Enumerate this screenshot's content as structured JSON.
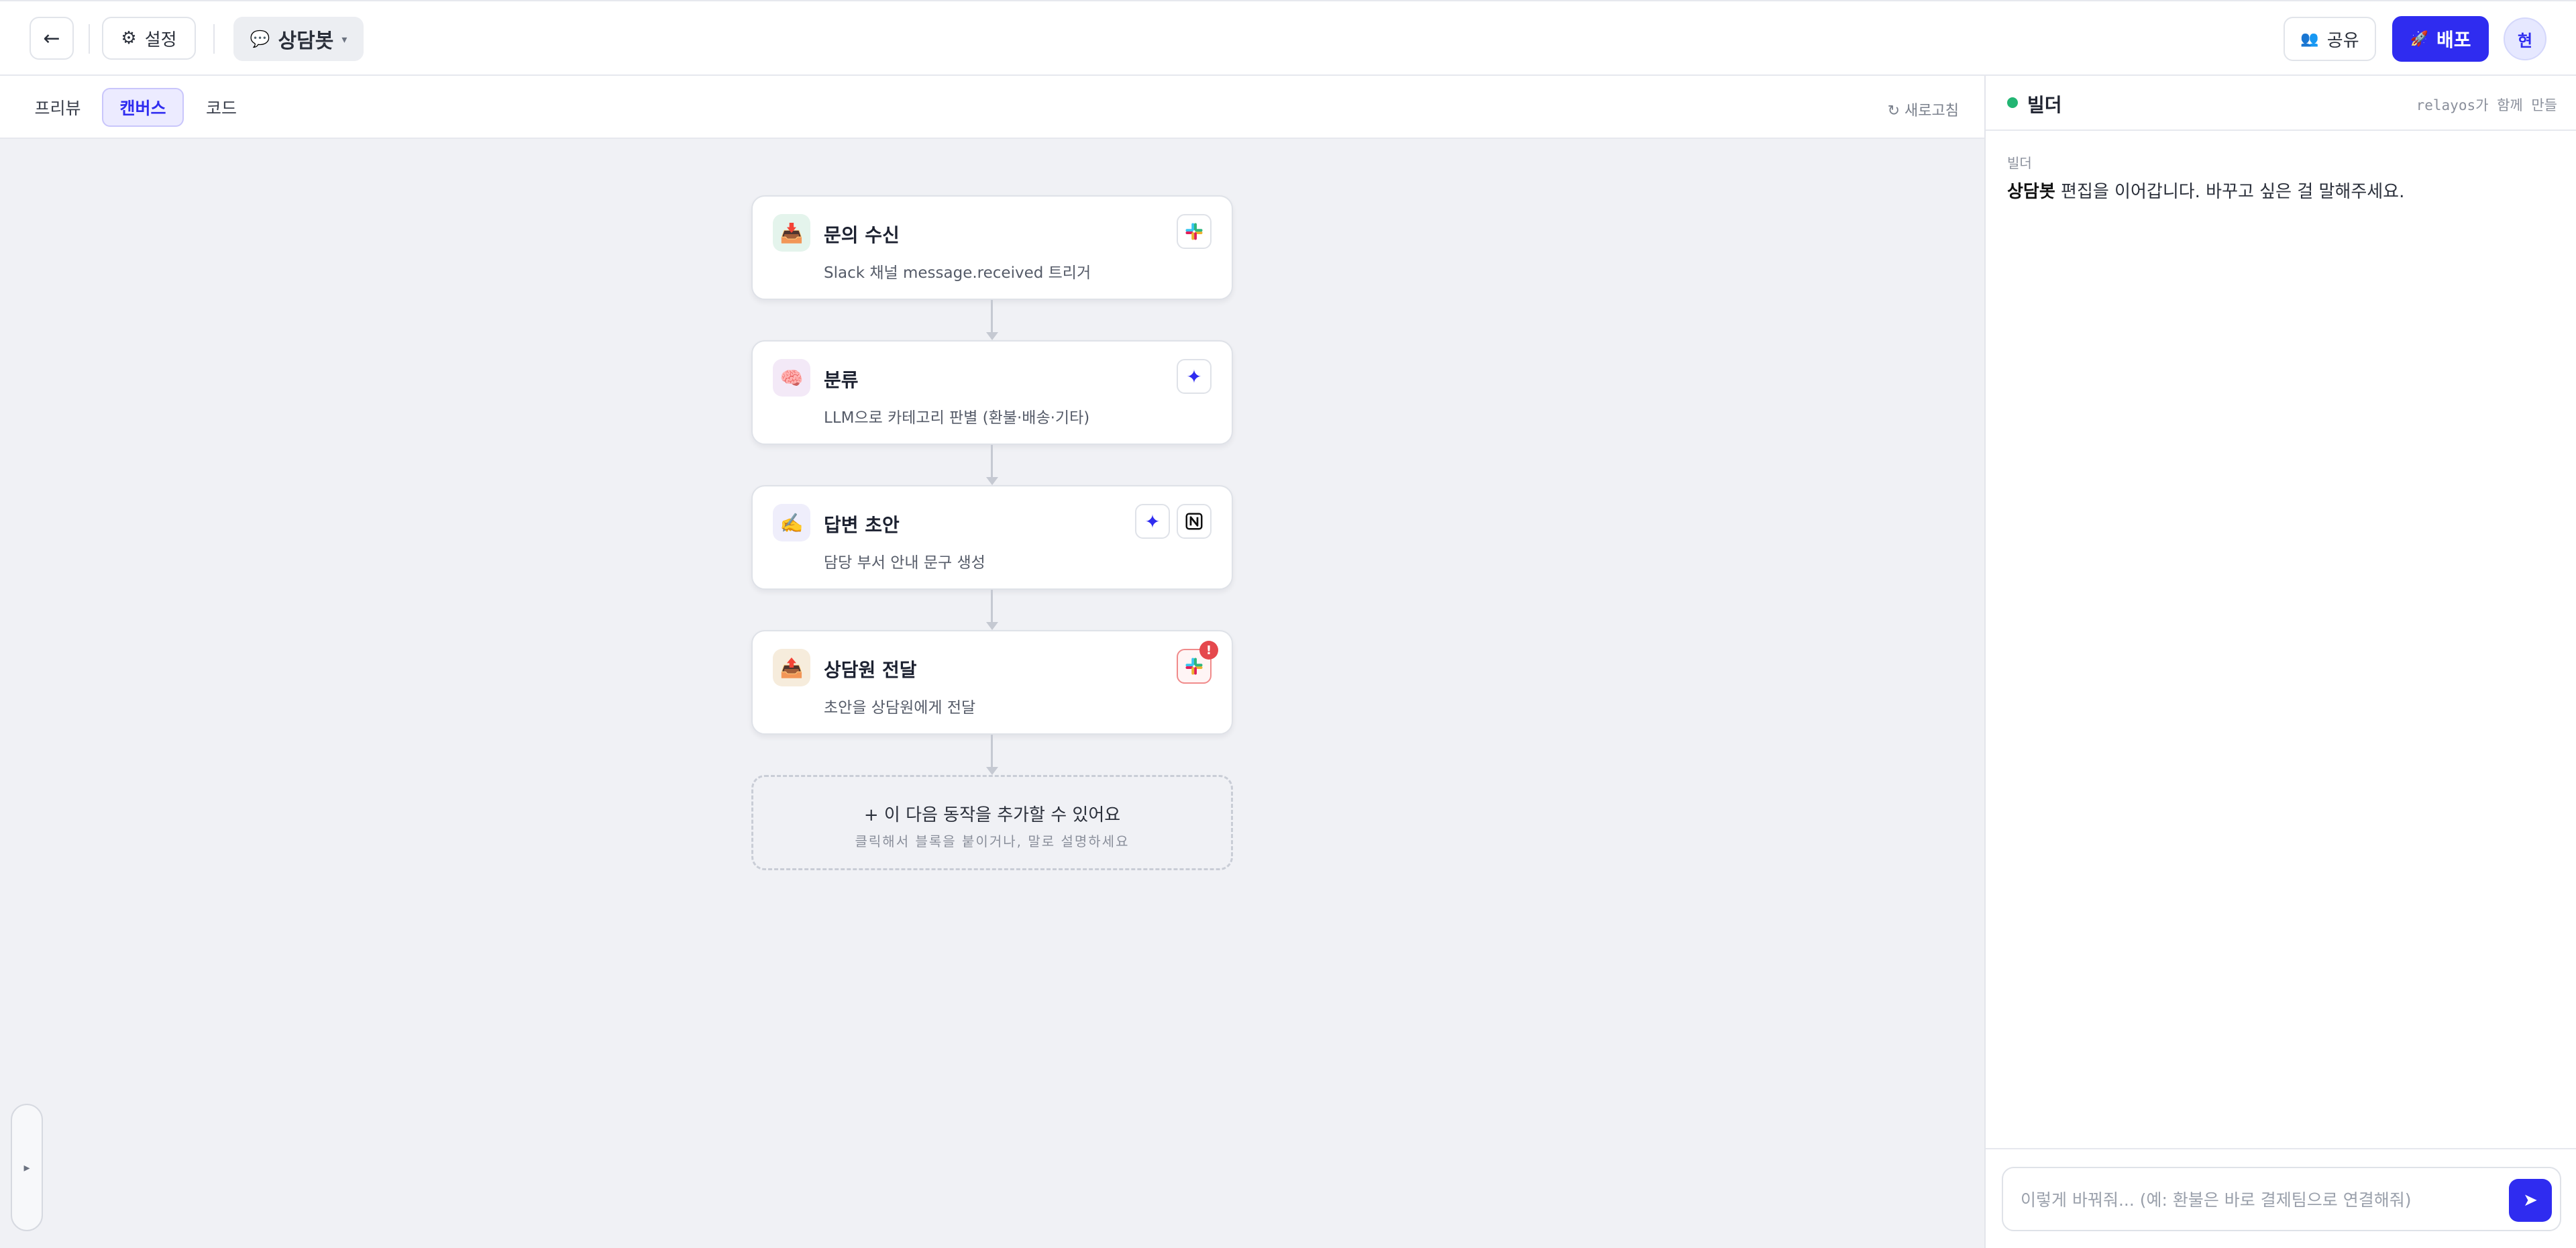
{
  "header": {
    "back_icon": "←",
    "settings_label": "설정",
    "settings_icon": "⚙",
    "bot_icon": "💬",
    "bot_name": "상담봇",
    "bot_caret": "▾",
    "share_icon": "👥",
    "share_label": "공유",
    "deploy_icon": "🚀",
    "deploy_label": "배포",
    "avatar": "현"
  },
  "tabs": [
    {
      "label": "프리뷰"
    },
    {
      "label": "캔버스",
      "active": true
    },
    {
      "label": "코드"
    }
  ],
  "refresh_label": "↻ 새로고침",
  "nodes": [
    {
      "icon": "📥",
      "title": "문의 수신",
      "desc": "Slack 채널 message.received 트리거",
      "badges": [
        "slack"
      ]
    },
    {
      "icon": "🧠",
      "title": "분류",
      "desc": "LLM으로 카테고리 판별 (환불·배송·기타)",
      "badges": [
        "sparkle"
      ]
    },
    {
      "icon": "✍️",
      "title": "답변 초안",
      "desc": "담당 부서 안내 문구 생성",
      "badges": [
        "sparkle",
        "notion"
      ]
    },
    {
      "icon": "📤",
      "title": "상담원 전달",
      "desc": "초안을 상담원에게 전달",
      "badges": [
        "slack-warning"
      ],
      "alert": "!"
    }
  ],
  "badge_glyphs": {
    "slack": "✱",
    "sparkle": "✦",
    "notion": "N"
  },
  "add_step": {
    "title": "+  이 다음 동작을 추가할 수 있어요",
    "subtitle": "클릭해서 블록을 붙이거나, 말로 설명하세요"
  },
  "collapse_icon": "▸",
  "panel": {
    "title": "빌더",
    "hint": "relayos가 함께 만들",
    "message_label": "빌더",
    "message_bold": "상담봇",
    "message_rest": " 편집을 이어갑니다. 바꾸고 싶은 걸 말해주세요.",
    "input_placeholder": "이렇게 바꿔줘... (예: 환불은 바로 결제팀으로 연결해줘)",
    "send_icon": "➤"
  },
  "colors": {
    "accent": "#2f2cf0",
    "online": "#22b573",
    "alert": "#e5484d",
    "canvas_bg": "#f0f1f5"
  }
}
